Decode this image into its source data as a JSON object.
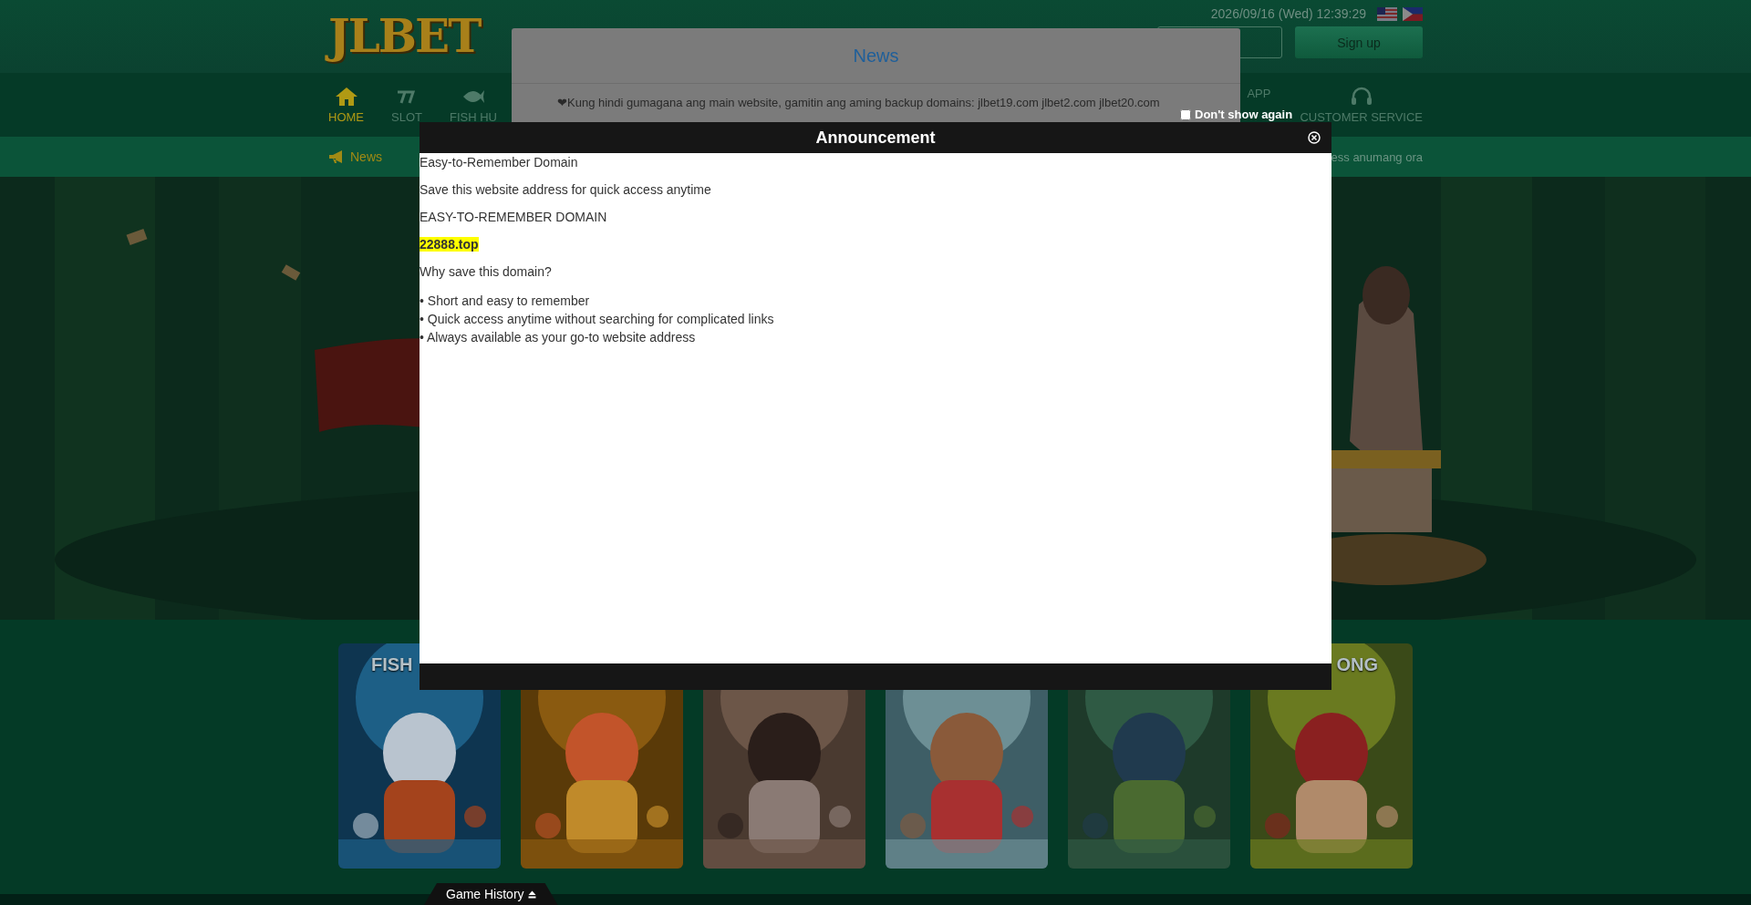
{
  "header": {
    "logo": "JLBET",
    "datetime": "2026/09/16 (Wed) 12:39:29",
    "signup_button": "Sign up"
  },
  "nav": {
    "items": [
      {
        "kind": "labeled",
        "label": "HOME",
        "selected": true
      },
      {
        "kind": "labeled",
        "label": "SLOT",
        "selected": false
      },
      {
        "kind": "labeled",
        "label": "FISH HU",
        "selected": false
      },
      {
        "kind": "badge",
        "label": "APP",
        "selected": false
      },
      {
        "kind": "labeled",
        "label": "CUSTOMER SERVICE",
        "selected": false
      }
    ]
  },
  "ticker": {
    "label": "News",
    "text": "ess anumang ora"
  },
  "banner": {
    "kind": "picture"
  },
  "cards": [
    {
      "title": "FISH",
      "kind": "picture"
    },
    {
      "kind": "picture"
    },
    {
      "kind": "picture"
    },
    {
      "kind": "picture"
    },
    {
      "kind": "picture"
    },
    {
      "title": "ONG",
      "kind": "picture"
    }
  ],
  "game_history": "Game History",
  "news_modal": {
    "title": "News",
    "items": [
      "❤Kung hindi gumagana ang main website, gamitin ang aming backup domains: jlbet19.com jlbet2.com jlbet20.com"
    ],
    "dont_show_again": {
      "label": "Don't show again",
      "checked": false
    }
  },
  "announcement": {
    "title": "Announcement",
    "blocks": [
      {
        "kind": "text",
        "text": "Easy-to-Remember Domain"
      },
      {
        "kind": "text",
        "text": "Save this website address for quick access anytime"
      },
      {
        "kind": "text",
        "text": "EASY-TO-REMEMBER DOMAIN"
      },
      {
        "kind": "highlight",
        "text": "22888.top"
      },
      {
        "kind": "text",
        "text": "Why save this domain?"
      },
      {
        "kind": "bullets",
        "lines": [
          "• Short and easy to remember",
          "• Quick access anytime without searching for complicated links",
          "• Always available as your go-to website address"
        ]
      }
    ]
  }
}
